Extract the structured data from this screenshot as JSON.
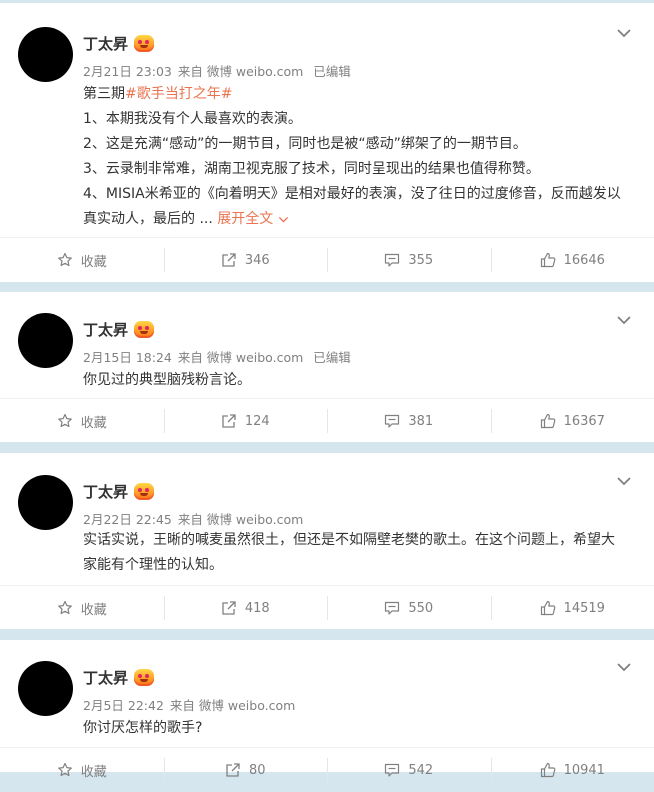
{
  "colors": {
    "page_bg": "#d6e6ef",
    "topic": "#eb7350",
    "meta_text": "#808080"
  },
  "posts": [
    {
      "author": "丁太昇",
      "date": "2月21日 23:03",
      "source_prefix": "来自",
      "source": "微博 weibo.com",
      "edited": "已编辑",
      "content": {
        "prefix": "第三期",
        "topic": "#歌手当打之年#",
        "lines": [
          "1、本期我没有个人最喜欢的表演。",
          "2、这是充满“感动”的一期节目，同时也是被“感动”绑架了的一期节目。",
          "3、云录制非常难，湖南卫视克服了技术，同时呈现出的结果也值得称赞。",
          "4、MISIA米希亚的《向着明天》是相对最好的表演，没了往日的过度修音，反而越发以真实动人，最后的"
        ],
        "ellipsis": "...",
        "expand": "展开全文"
      },
      "actions": {
        "favorite": "收藏",
        "repost": "346",
        "comment": "355",
        "like": "16646"
      }
    },
    {
      "author": "丁太昇",
      "date": "2月15日 18:24",
      "source_prefix": "来自",
      "source": "微博 weibo.com",
      "edited": "已编辑",
      "content": {
        "lines": [
          "你见过的典型脑残粉言论。"
        ]
      },
      "actions": {
        "favorite": "收藏",
        "repost": "124",
        "comment": "381",
        "like": "16367"
      }
    },
    {
      "author": "丁太昇",
      "date": "2月22日 22:45",
      "source_prefix": "来自",
      "source": "微博 weibo.com",
      "content": {
        "lines": [
          "实话实说，王晰的喊麦虽然很土，但还是不如隔壁老樊的歌土。在这个问题上，希望大家能有个理性的认知。"
        ]
      },
      "actions": {
        "favorite": "收藏",
        "repost": "418",
        "comment": "550",
        "like": "14519"
      }
    },
    {
      "author": "丁太昇",
      "date": "2月5日 22:42",
      "source_prefix": "来自",
      "source": "微博 weibo.com",
      "content": {
        "lines": [
          "你讨厌怎样的歌手?"
        ]
      },
      "actions": {
        "favorite": "收藏",
        "repost": "80",
        "comment": "542",
        "like": "10941"
      }
    }
  ]
}
